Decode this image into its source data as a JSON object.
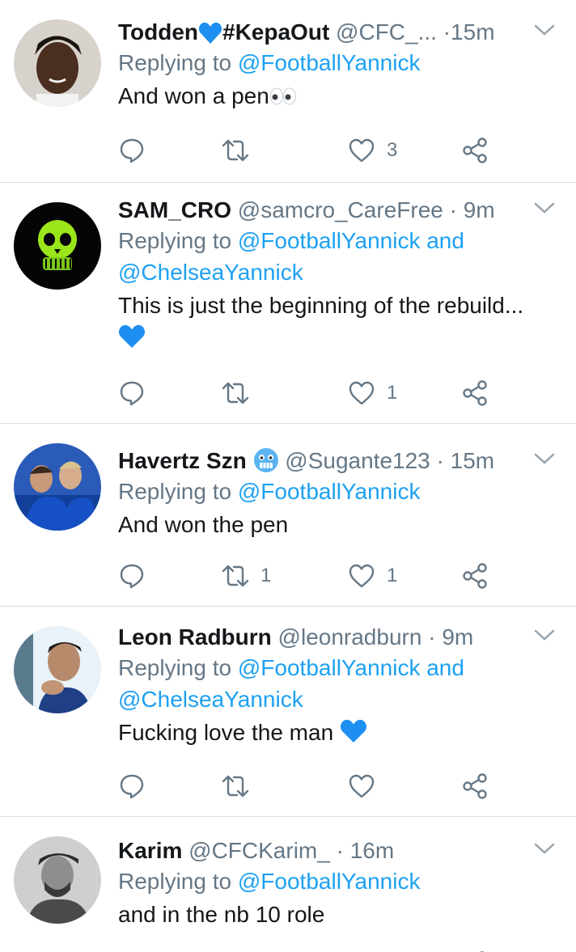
{
  "tweets": [
    {
      "name": "Todden",
      "name_suffix": "#KepaOut",
      "handle": "@CFC_...",
      "separator": "·",
      "time": "15m",
      "reply_prefix": "Replying to",
      "reply_links": [
        "@FootballYannick"
      ],
      "reply_joiner": "",
      "text": "And won a pen",
      "replies": "",
      "retweets": "",
      "likes": "3"
    },
    {
      "name": "SAM_CRO",
      "handle": "@samcro_CareFree",
      "separator": "·",
      "time": "9m",
      "reply_prefix": "Replying to",
      "reply_links": [
        "@FootballYannick",
        "@ChelseaYannick"
      ],
      "reply_joiner": "and",
      "text": "This is just the beginning of the rebuild...",
      "replies": "",
      "retweets": "",
      "likes": "1"
    },
    {
      "name": "Havertz Szn",
      "handle": "@Sugante123",
      "separator": "·",
      "time": "15m",
      "reply_prefix": "Replying to",
      "reply_links": [
        "@FootballYannick"
      ],
      "reply_joiner": "",
      "text": "And won the pen",
      "replies": "",
      "retweets": "1",
      "likes": "1"
    },
    {
      "name": "Leon Radburn",
      "handle": "@leonradburn",
      "separator": "·",
      "time": "9m",
      "reply_prefix": "Replying to",
      "reply_links": [
        "@FootballYannick",
        "@ChelseaYannick"
      ],
      "reply_joiner": "and",
      "text": "Fucking love the man",
      "replies": "",
      "retweets": "",
      "likes": ""
    },
    {
      "name": "Karim",
      "handle": "@CFCKarim_",
      "separator": "·",
      "time": "16m",
      "reply_prefix": "Replying to",
      "reply_links": [
        "@FootballYannick"
      ],
      "reply_joiner": "",
      "text": "and in the nb 10 role",
      "replies": "",
      "retweets": "",
      "likes": ""
    }
  ],
  "colors": {
    "link": "#1da1f2",
    "secondary": "#657786",
    "primary": "#14171a",
    "divider": "#d9dee2",
    "heart_emoji": "#1d8ff0"
  },
  "icons": [
    "chevron-down-icon",
    "reply-icon",
    "retweet-icon",
    "like-icon",
    "share-icon",
    "blue-heart-emoji",
    "eyes-emoji",
    "cold-face-emoji"
  ]
}
